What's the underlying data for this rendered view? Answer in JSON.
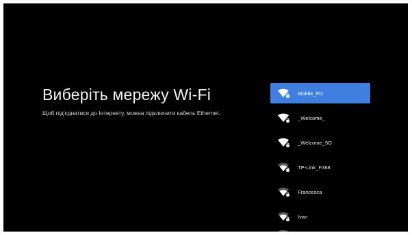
{
  "page": {
    "title": "Виберіть мережу Wi-Fi",
    "subtitle": "Щоб під'єднатися до Інтернету, можна підключити кабель Ethernet."
  },
  "networks": [
    {
      "ssid": "Mobile_FD",
      "selected": true,
      "signal": "full",
      "secured": true,
      "icon": "wifi-locked-icon"
    },
    {
      "ssid": "_Welcome_",
      "selected": false,
      "signal": "full",
      "secured": true,
      "icon": "wifi-locked-icon"
    },
    {
      "ssid": "_Welcome_5G",
      "selected": false,
      "signal": "full",
      "secured": true,
      "icon": "wifi-locked-icon"
    },
    {
      "ssid": "TP-Link_F388",
      "selected": false,
      "signal": "high",
      "secured": true,
      "icon": "wifi-locked-icon"
    },
    {
      "ssid": "Francesca",
      "selected": false,
      "signal": "high",
      "secured": true,
      "icon": "wifi-locked-icon"
    },
    {
      "ssid": "Ivan",
      "selected": false,
      "signal": "high",
      "secured": true,
      "icon": "wifi-locked-icon"
    }
  ],
  "colors": {
    "background": "#000000",
    "selected_row": "#3f7fe0",
    "text": "#f1f1f1"
  }
}
